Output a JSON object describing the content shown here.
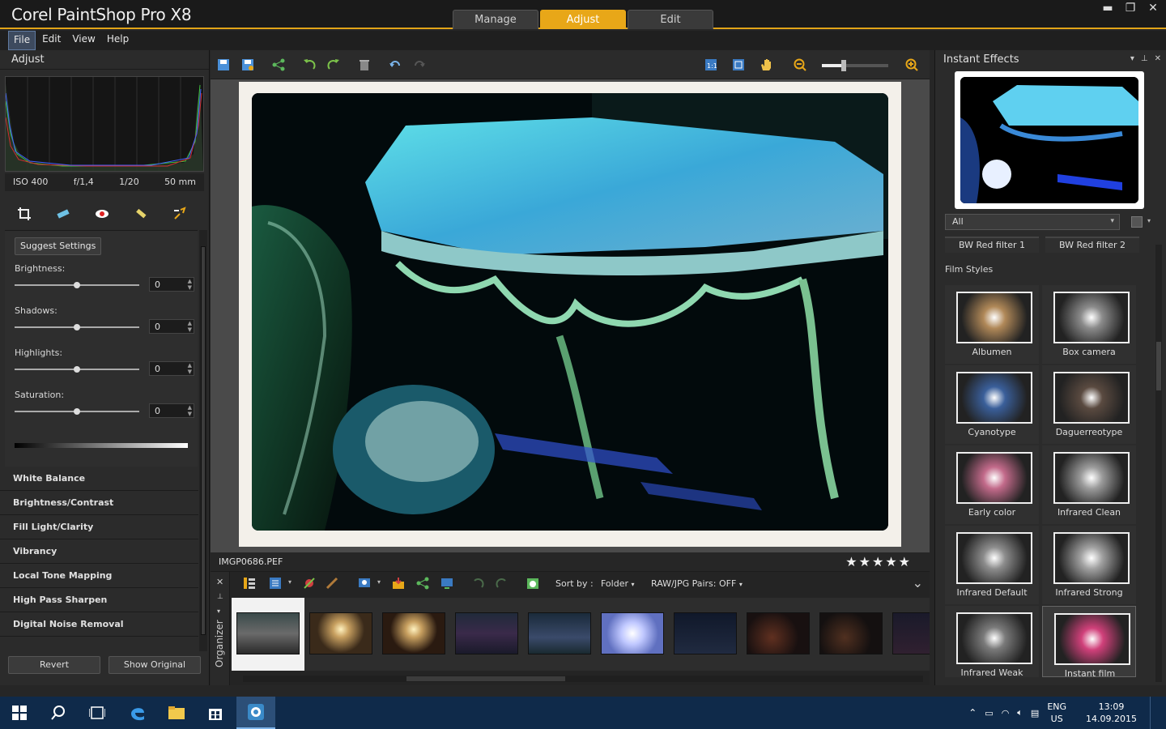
{
  "title": "Corel PaintShop Pro X8",
  "mode_tabs": [
    "Manage",
    "Adjust",
    "Edit"
  ],
  "window_controls": {
    "minimize": "▬",
    "restore": "❐",
    "close": "✕"
  },
  "menu": [
    "File",
    "Edit",
    "View",
    "Help"
  ],
  "left_panel": {
    "title": "Adjust",
    "exif": {
      "iso": "ISO 400",
      "aperture": "f/1,4",
      "shutter": "1/20",
      "focal": "50 mm"
    },
    "suggest_label": "Suggest Settings",
    "sliders": [
      {
        "label": "Brightness:",
        "value": "0"
      },
      {
        "label": "Shadows:",
        "value": "0"
      },
      {
        "label": "Highlights:",
        "value": "0"
      },
      {
        "label": "Saturation:",
        "value": "0"
      }
    ],
    "sections": [
      "White Balance",
      "Brightness/Contrast",
      "Fill Light/Clarity",
      "Vibrancy",
      "Local Tone Mapping",
      "High Pass Sharpen",
      "Digital Noise Removal"
    ],
    "revert_label": "Revert",
    "show_original_label": "Show Original"
  },
  "center": {
    "filename": "IMGP0686.PEF",
    "rating": "★★★★★",
    "organizer_label": "Organizer",
    "sort_by_label": "Sort by :",
    "sort_value": "Folder",
    "raw_pairs_label": "RAW/JPG Pairs: OFF"
  },
  "right_panel": {
    "title": "Instant Effects",
    "filter_value": "All",
    "bw_buttons": [
      "BW Red filter 1",
      "BW Red filter 2"
    ],
    "section_title": "Film Styles",
    "effects": [
      {
        "label": "Albumen",
        "color": "#b08858"
      },
      {
        "label": "Box camera",
        "color": "#8a8a8a"
      },
      {
        "label": "Cyanotype",
        "color": "#3a5f9a"
      },
      {
        "label": "Daguerreotype",
        "color": "#5a4a40"
      },
      {
        "label": "Early color",
        "color": "#c26a8a"
      },
      {
        "label": "Infrared Clean",
        "color": "#9a9a9a"
      },
      {
        "label": "Infrared Default",
        "color": "#8c8c8c"
      },
      {
        "label": "Infrared Strong",
        "color": "#a0a0a0"
      },
      {
        "label": "Infrared Weak",
        "color": "#7a7a7a"
      },
      {
        "label": "Instant film",
        "color": "#d0407a"
      }
    ]
  },
  "taskbar": {
    "language": "ENG",
    "region": "US",
    "time": "13:09",
    "date": "14.09.2015"
  },
  "colors": {
    "accent": "#e8a718",
    "taskbar": "#0f2a4a"
  }
}
